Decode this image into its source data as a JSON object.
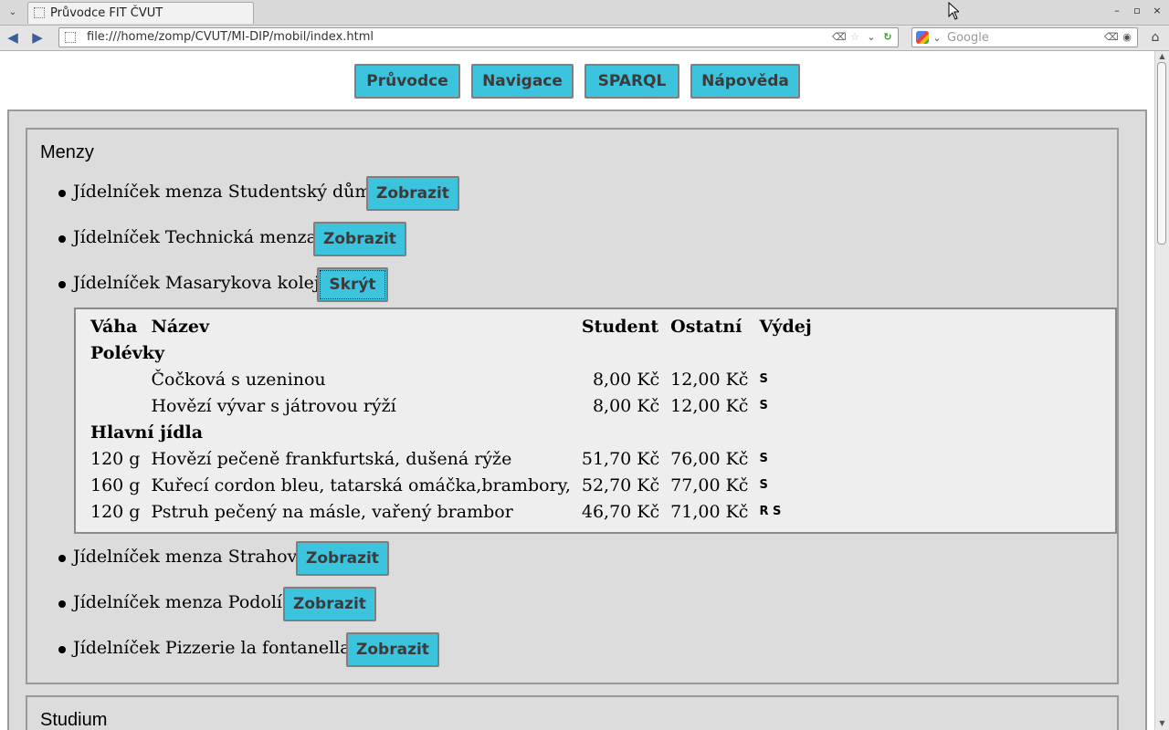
{
  "browser": {
    "tab_title": "Průvodce FIT ČVUT",
    "url": "file:///home/zomp/CVUT/MI-DIP/mobil/index.html",
    "search_placeholder": "Google",
    "win_minimize": "–",
    "win_maximize": "▫",
    "win_close": "×"
  },
  "nav_buttons": [
    "Průvodce",
    "Navigace",
    "SPARQL",
    "Nápověda"
  ],
  "menzy": {
    "title": "Menzy",
    "items": [
      {
        "label": "Jídelníček menza Studentský dům",
        "button": "Zobrazit"
      },
      {
        "label": "Jídelníček Technická menza",
        "button": "Zobrazit"
      },
      {
        "label": "Jídelníček Masarykova kolej",
        "button": "Skrýt"
      },
      {
        "label": "Jídelníček menza Strahov",
        "button": "Zobrazit"
      },
      {
        "label": "Jídelníček menza Podolí",
        "button": "Zobrazit"
      },
      {
        "label": "Jídelníček Pizzerie la fontanella",
        "button": "Zobrazit"
      }
    ],
    "table": {
      "headers": [
        "Váha",
        "Název",
        "Student",
        "Ostatní",
        "Výdej"
      ],
      "categories": [
        {
          "name": "Polévky",
          "rows": [
            {
              "vaha": "",
              "nazev": "Čočková s uzeninou",
              "student": "8,00 Kč",
              "ostatni": "12,00 Kč",
              "vydej": "S"
            },
            {
              "vaha": "",
              "nazev": "Hovězí vývar s játrovou rýží",
              "student": "8,00 Kč",
              "ostatni": "12,00 Kč",
              "vydej": "S"
            }
          ]
        },
        {
          "name": "Hlavní jídla",
          "rows": [
            {
              "vaha": "120 g",
              "nazev": "Hovězí pečeně frankfurtská, dušená rýže",
              "student": "51,70 Kč",
              "ostatni": "76,00 Kč",
              "vydej": "S"
            },
            {
              "vaha": "160 g",
              "nazev": "Kuřecí cordon bleu, tatarská omáčka,brambory,",
              "student": "52,70 Kč",
              "ostatni": "77,00 Kč",
              "vydej": "S"
            },
            {
              "vaha": "120 g",
              "nazev": "Pstruh pečený na másle, vařený brambor",
              "student": "46,70 Kč",
              "ostatni": "71,00 Kč",
              "vydej": "R S"
            }
          ]
        }
      ]
    }
  },
  "studium": {
    "title": "Studium"
  },
  "colors": {
    "accent": "#3cc3dd",
    "panel": "#dcdcdc",
    "border": "#9a9a9a"
  }
}
